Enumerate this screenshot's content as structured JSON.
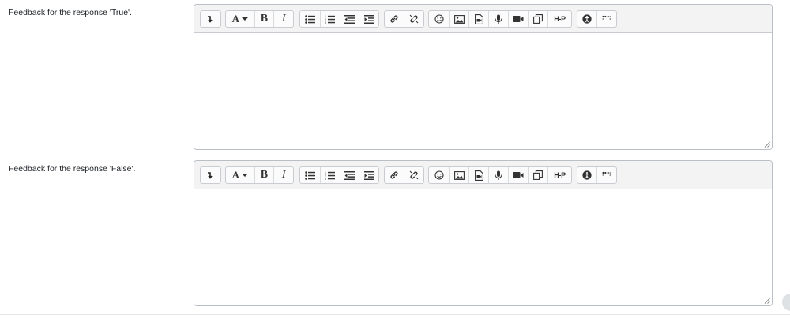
{
  "fields": [
    {
      "label": "Feedback for the response 'True'.",
      "value": ""
    },
    {
      "label": "Feedback for the response 'False'.",
      "value": ""
    }
  ],
  "toolbar": {
    "show_more": "show-more-icon",
    "paragraph_style": "A",
    "bold": "B",
    "italic": "I",
    "h5p": "H-P"
  }
}
